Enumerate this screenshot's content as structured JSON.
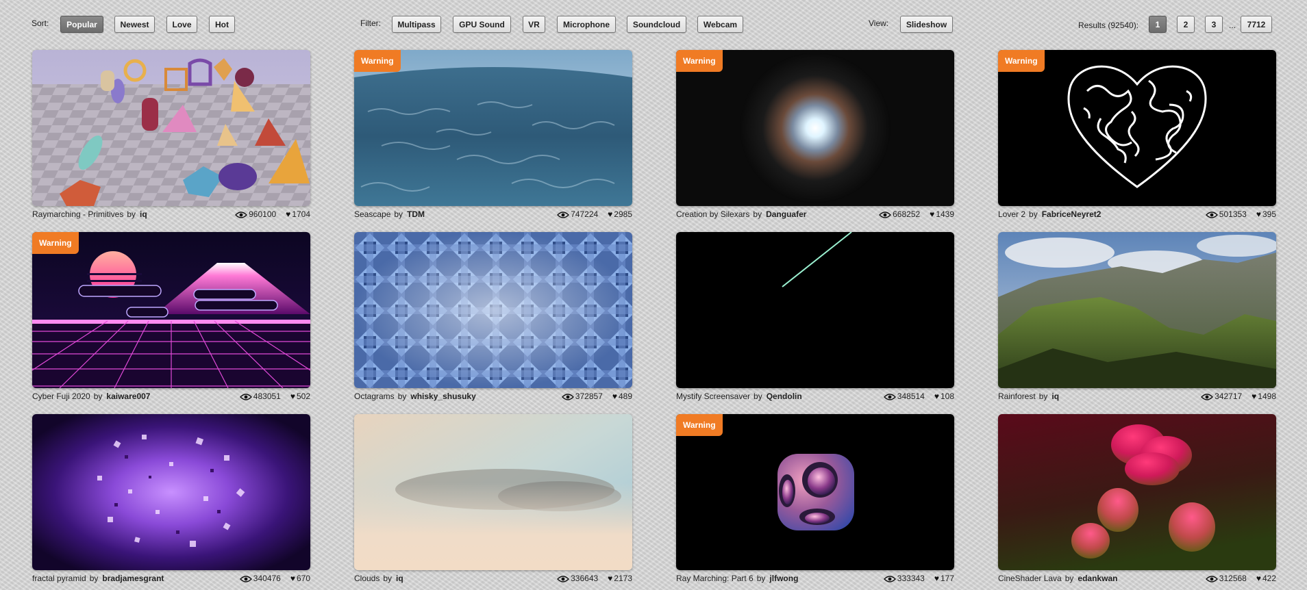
{
  "sort": {
    "label": "Sort:",
    "options": [
      "Popular",
      "Newest",
      "Love",
      "Hot"
    ],
    "active": "Popular"
  },
  "filter": {
    "label": "Filter:",
    "options": [
      "Multipass",
      "GPU Sound",
      "VR",
      "Microphone",
      "Soundcloud",
      "Webcam"
    ]
  },
  "view": {
    "label": "View:",
    "option": "Slideshow"
  },
  "results": {
    "label": "Results (92540):",
    "pages": [
      "1",
      "2",
      "3"
    ],
    "ellipsis": "...",
    "last_page": "7712",
    "current_page": "1"
  },
  "warning_label": "Warning",
  "by_label": "by",
  "shaders": [
    {
      "title": "Raymarching - Primitives",
      "author": "iq",
      "views": "960100",
      "likes": "1704",
      "warning": false,
      "thumb": "primitives"
    },
    {
      "title": "Seascape",
      "author": "TDM",
      "views": "747224",
      "likes": "2985",
      "warning": true,
      "thumb": "seascape"
    },
    {
      "title": "Creation by Silexars",
      "author": "Danguafer",
      "views": "668252",
      "likes": "1439",
      "warning": true,
      "thumb": "creation"
    },
    {
      "title": "Lover 2",
      "author": "FabriceNeyret2",
      "views": "501353",
      "likes": "395",
      "warning": true,
      "thumb": "heart"
    },
    {
      "title": "Cyber Fuji 2020",
      "author": "kaiware007",
      "views": "483051",
      "likes": "502",
      "warning": true,
      "thumb": "fuji"
    },
    {
      "title": "Octagrams",
      "author": "whisky_shusuky",
      "views": "372857",
      "likes": "489",
      "warning": false,
      "thumb": "octagrams"
    },
    {
      "title": "Mystify Screensaver",
      "author": "Qendolin",
      "views": "348514",
      "likes": "108",
      "warning": false,
      "thumb": "mystify"
    },
    {
      "title": "Rainforest",
      "author": "iq",
      "views": "342717",
      "likes": "1498",
      "warning": false,
      "thumb": "rainforest"
    },
    {
      "title": "fractal pyramid",
      "author": "bradjamesgrant",
      "views": "340476",
      "likes": "670",
      "warning": false,
      "thumb": "fractal"
    },
    {
      "title": "Clouds",
      "author": "iq",
      "views": "336643",
      "likes": "2173",
      "warning": false,
      "thumb": "clouds"
    },
    {
      "title": "Ray Marching: Part 6",
      "author": "jlfwong",
      "views": "333343",
      "likes": "177",
      "warning": true,
      "thumb": "raymarch6"
    },
    {
      "title": "CineShader Lava",
      "author": "edankwan",
      "views": "312568",
      "likes": "422",
      "warning": false,
      "thumb": "lava"
    }
  ],
  "colors": {
    "warning": "#f07b24",
    "active_button": "#7a7a7a"
  }
}
